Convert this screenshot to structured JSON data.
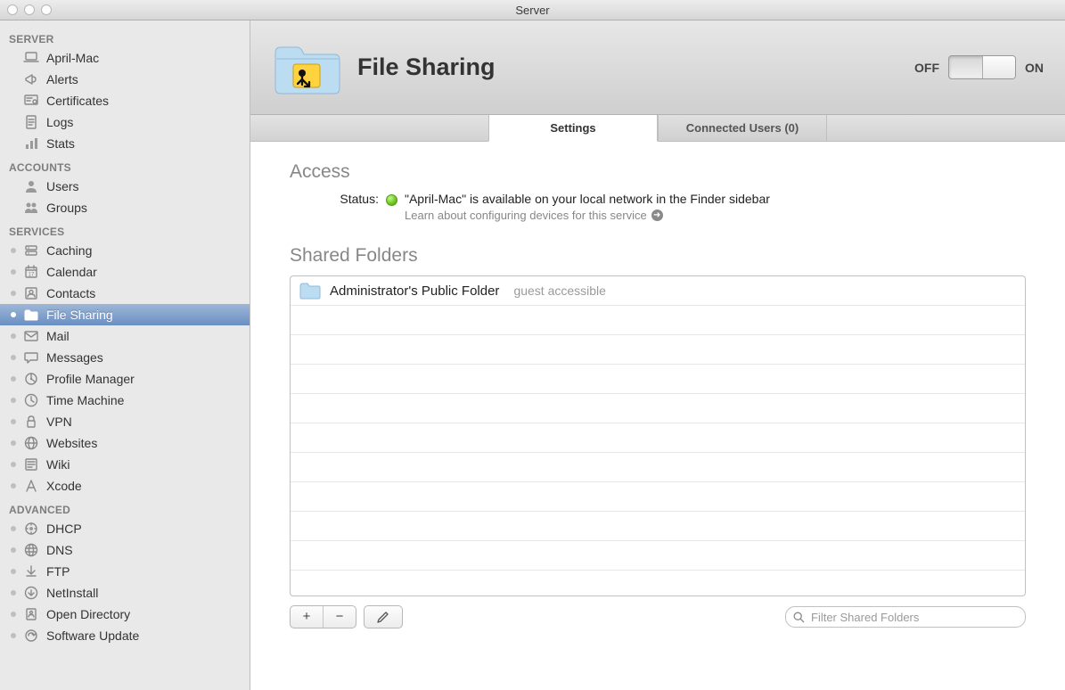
{
  "window": {
    "title": "Server"
  },
  "sidebar": {
    "groups": [
      {
        "label": "SERVER",
        "items": [
          {
            "label": "April-Mac",
            "icon": "laptop"
          },
          {
            "label": "Alerts",
            "icon": "megaphone"
          },
          {
            "label": "Certificates",
            "icon": "certificate"
          },
          {
            "label": "Logs",
            "icon": "log"
          },
          {
            "label": "Stats",
            "icon": "stats"
          }
        ]
      },
      {
        "label": "ACCOUNTS",
        "items": [
          {
            "label": "Users",
            "icon": "user"
          },
          {
            "label": "Groups",
            "icon": "group"
          }
        ]
      },
      {
        "label": "SERVICES",
        "items": [
          {
            "label": "Caching",
            "icon": "caching",
            "dot": true
          },
          {
            "label": "Calendar",
            "icon": "calendar",
            "dot": true
          },
          {
            "label": "Contacts",
            "icon": "contacts",
            "dot": true
          },
          {
            "label": "File Sharing",
            "icon": "filesharing",
            "dot": true,
            "selected": true
          },
          {
            "label": "Mail",
            "icon": "mail",
            "dot": true
          },
          {
            "label": "Messages",
            "icon": "messages",
            "dot": true
          },
          {
            "label": "Profile Manager",
            "icon": "profile",
            "dot": true
          },
          {
            "label": "Time Machine",
            "icon": "timemachine",
            "dot": true
          },
          {
            "label": "VPN",
            "icon": "vpn",
            "dot": true
          },
          {
            "label": "Websites",
            "icon": "websites",
            "dot": true
          },
          {
            "label": "Wiki",
            "icon": "wiki",
            "dot": true
          },
          {
            "label": "Xcode",
            "icon": "xcode",
            "dot": true
          }
        ]
      },
      {
        "label": "ADVANCED",
        "items": [
          {
            "label": "DHCP",
            "icon": "dhcp",
            "dot": true
          },
          {
            "label": "DNS",
            "icon": "dns",
            "dot": true
          },
          {
            "label": "FTP",
            "icon": "ftp",
            "dot": true
          },
          {
            "label": "NetInstall",
            "icon": "netinstall",
            "dot": true
          },
          {
            "label": "Open Directory",
            "icon": "opendir",
            "dot": true
          },
          {
            "label": "Software Update",
            "icon": "swupdate",
            "dot": true
          }
        ]
      }
    ]
  },
  "header": {
    "title": "File Sharing",
    "switch_off": "OFF",
    "switch_on": "ON",
    "switch_state": "on"
  },
  "tabs": {
    "settings": "Settings",
    "connected": "Connected Users (0)"
  },
  "access": {
    "section_title": "Access",
    "status_label": "Status:",
    "status_text": "\"April-Mac\" is available on your local network in the Finder sidebar",
    "learn_text": "Learn about configuring devices for this service"
  },
  "shared": {
    "section_title": "Shared Folders",
    "items": [
      {
        "name": "Administrator's Public Folder",
        "sub": "guest accessible"
      }
    ],
    "search_placeholder": "Filter Shared Folders"
  },
  "buttons": {
    "plus": "+",
    "minus": "−"
  }
}
